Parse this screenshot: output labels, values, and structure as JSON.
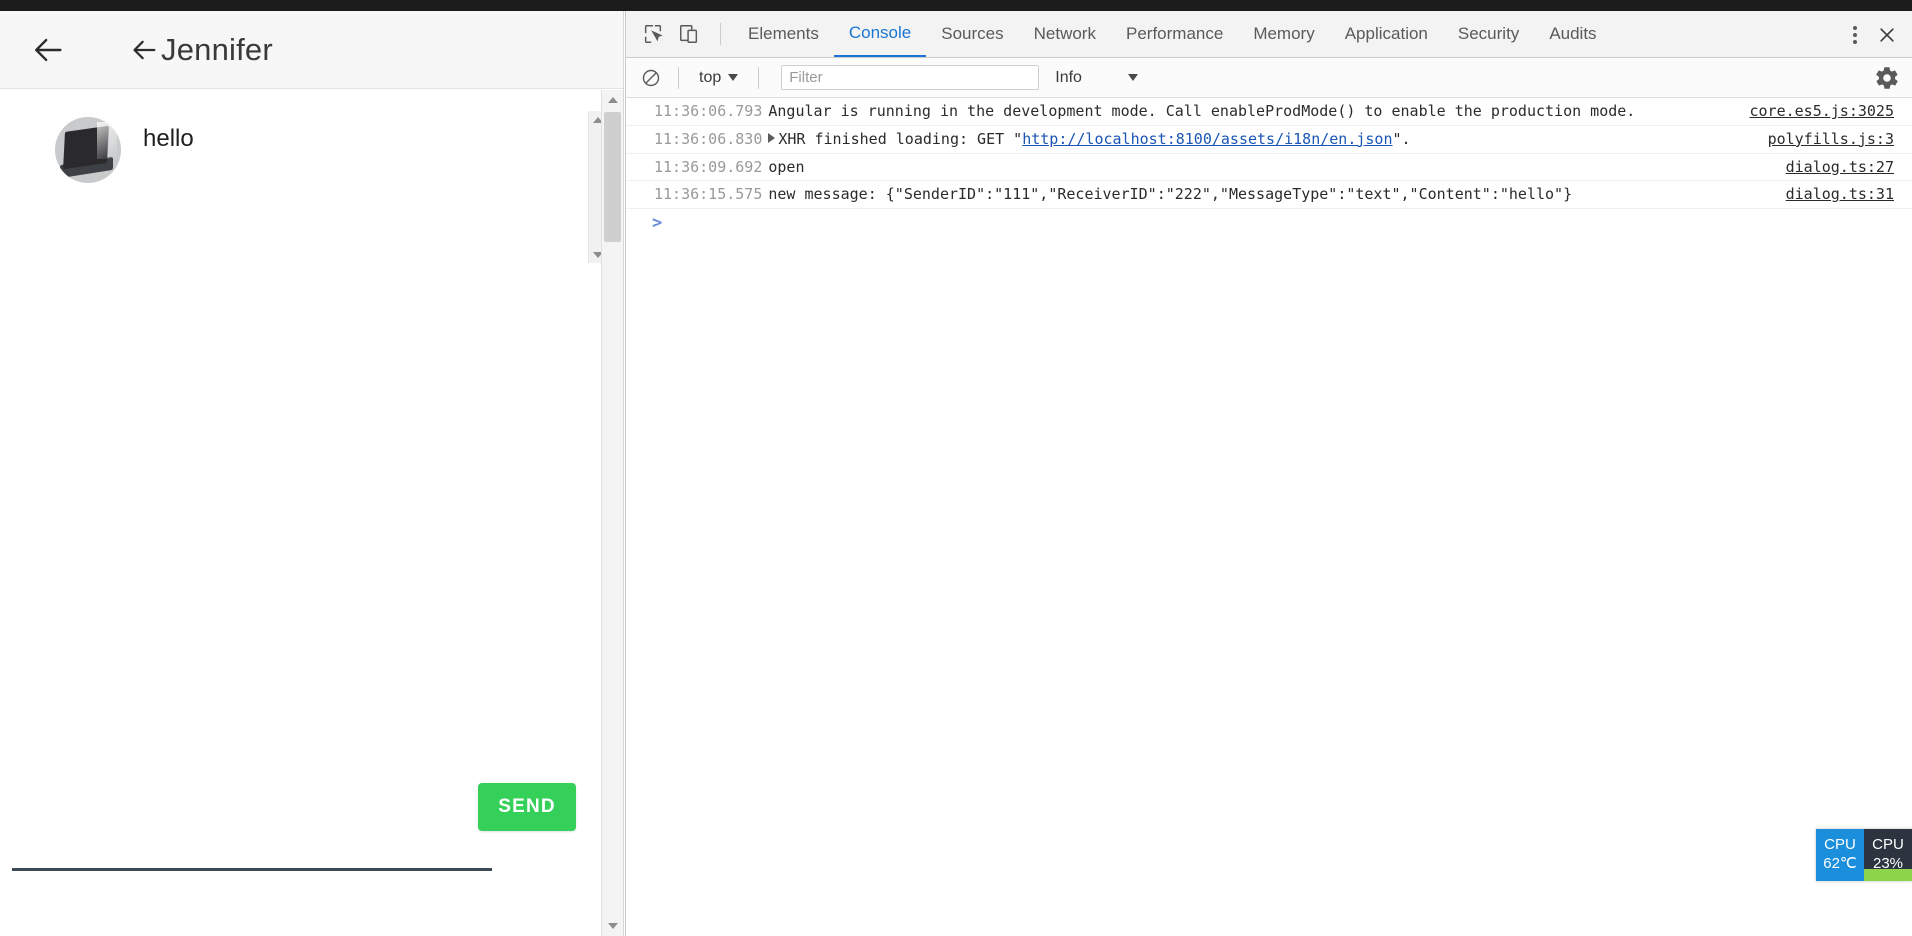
{
  "app": {
    "back_arrow_outer": "back-arrow-outer",
    "back_arrow_inner": "back-arrow-inner",
    "title": "Jennifer",
    "messages": [
      {
        "sender": "Jennifer",
        "text": "hello",
        "avatar": "laptop-photo"
      }
    ],
    "composer": {
      "input_value": "",
      "input_placeholder": "",
      "send_label": "SEND"
    }
  },
  "devtools": {
    "icons": {
      "inspect": "inspect-element-icon",
      "device": "device-toolbar-icon",
      "kebab": "more-options-icon",
      "close": "close-icon",
      "clear": "clear-console-icon",
      "gear": "settings-gear-icon"
    },
    "tabs": [
      {
        "label": "Elements",
        "active": false
      },
      {
        "label": "Console",
        "active": true
      },
      {
        "label": "Sources",
        "active": false
      },
      {
        "label": "Network",
        "active": false
      },
      {
        "label": "Performance",
        "active": false
      },
      {
        "label": "Memory",
        "active": false
      },
      {
        "label": "Application",
        "active": false
      },
      {
        "label": "Security",
        "active": false
      },
      {
        "label": "Audits",
        "active": false
      }
    ],
    "filterbar": {
      "context": "top",
      "filter_value": "",
      "filter_placeholder": "Filter",
      "level": "Info"
    },
    "console_rows": [
      {
        "timestamp": "11:36:06.793",
        "text": "Angular is running in the development mode. Call enableProdMode() to enable the production mode.",
        "source": "core.es5.js:3025",
        "expandable": false,
        "link": "",
        "prefix": "",
        "suffix": ""
      },
      {
        "timestamp": "11:36:06.830",
        "text": "",
        "prefix": "XHR finished loading: GET \"",
        "link": "http://localhost:8100/assets/i18n/en.json",
        "suffix": "\".",
        "source": "polyfills.js:3",
        "expandable": true
      },
      {
        "timestamp": "11:36:09.692",
        "text": "open",
        "source": "dialog.ts:27",
        "expandable": false,
        "link": "",
        "prefix": "",
        "suffix": ""
      },
      {
        "timestamp": "11:36:15.575",
        "text": "new message: {\"SenderID\":\"111\",\"ReceiverID\":\"222\",\"MessageType\":\"text\",\"Content\":\"hello\"}",
        "source": "dialog.ts:31",
        "expandable": false,
        "link": "",
        "prefix": "",
        "suffix": ""
      }
    ],
    "prompt": ">"
  },
  "cpu_widget": {
    "temp_label": "CPU",
    "temp_value": "62℃",
    "usage_label": "CPU",
    "usage_value": "23%"
  },
  "colors": {
    "accent_tab": "#1976d2",
    "send_button": "#35d05a",
    "cpu_temp_bg": "#1c8fdc",
    "cpu_usage_bg": "#2c3440",
    "cpu_usage_fill": "#8ed44a",
    "link": "#1a55b5"
  }
}
